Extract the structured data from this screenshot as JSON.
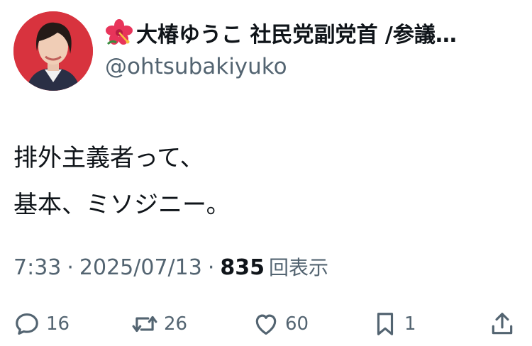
{
  "author": {
    "display_name": "大椿ゆうこ 社民党副党首 /参議…",
    "handle": "@ohtsubakiyuko",
    "name_icon": "hibiscus-flower-icon",
    "avatar_bg": "#d8333e"
  },
  "post": {
    "lines": [
      "排外主義者って、",
      "基本、ミソジニー。"
    ]
  },
  "meta": {
    "time": "7:33",
    "separator": "·",
    "date": "2025/07/13",
    "views_count": "835",
    "views_label": "回表示"
  },
  "actions": {
    "reply_count": "16",
    "repost_count": "26",
    "like_count": "60",
    "bookmark_count": "1"
  },
  "colors": {
    "text": "#0f1419",
    "secondary": "#536471",
    "avatar_bg": "#d8333e"
  }
}
